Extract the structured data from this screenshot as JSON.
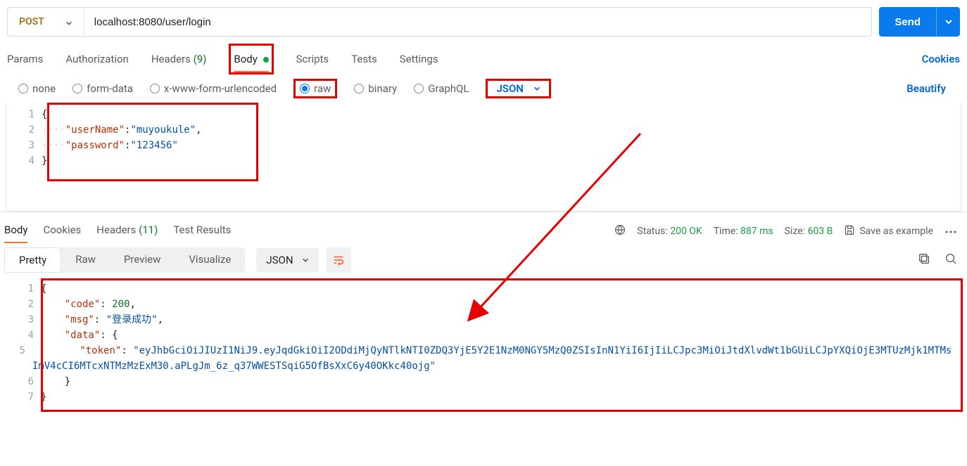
{
  "request": {
    "method": "POST",
    "url": "localhost:8080/user/login",
    "send_label": "Send",
    "tabs": {
      "params": "Params",
      "auth": "Authorization",
      "headers": "Headers",
      "headers_count": "(9)",
      "body": "Body",
      "scripts": "Scripts",
      "tests": "Tests",
      "settings": "Settings"
    },
    "cookies_label": "Cookies",
    "body_types": {
      "none": "none",
      "form": "form-data",
      "urlenc": "x-www-form-urlencoded",
      "raw": "raw",
      "binary": "binary",
      "graphql": "GraphQL"
    },
    "content_type": "JSON",
    "beautify_label": "Beautify",
    "body_lines": {
      "l1": "{",
      "l2_key": "\"userName\"",
      "l2_val": "\"muyoukule\"",
      "l3_key": "\"password\"",
      "l3_val": "\"123456\"",
      "l4": "}"
    }
  },
  "response": {
    "tabs": {
      "body": "Body",
      "cookies": "Cookies",
      "headers": "Headers",
      "headers_count": "(11)",
      "tests": "Test Results"
    },
    "status_label": "Status:",
    "status_value": "200 OK",
    "time_label": "Time:",
    "time_value": "887 ms",
    "size_label": "Size:",
    "size_value": "603 B",
    "save_as_example": "Save as example",
    "view_tabs": {
      "pretty": "Pretty",
      "raw": "Raw",
      "preview": "Preview",
      "visualize": "Visualize"
    },
    "format": "JSON",
    "lines": {
      "l1": "{",
      "l2_key": "\"code\"",
      "l2_val": "200",
      "l3_key": "\"msg\"",
      "l3_val": "\"登录成功\"",
      "l4_key": "\"data\"",
      "l4_val": "{",
      "l5_key": "\"token\"",
      "l5_val": "\"eyJhbGciOiJIUzI1NiJ9.eyJqdGkiOiI2ODdiMjQyNTlkNTI0ZDQ3YjE5Y2E1NzM0NGY5MzQ0ZSIsInN1YiI6IjIiLCJpc3MiOiJtdXlvdWt1bGUiLCJpYXQiOjE3MTUzMjk1MTMsImV4cCI6MTcxNTMzMzExM30.aPLgJm_6z_q37WWESTSqiG5OfBsXxC6y40OKkc40ojg\"",
      "l6": "}",
      "l7": "}"
    }
  }
}
